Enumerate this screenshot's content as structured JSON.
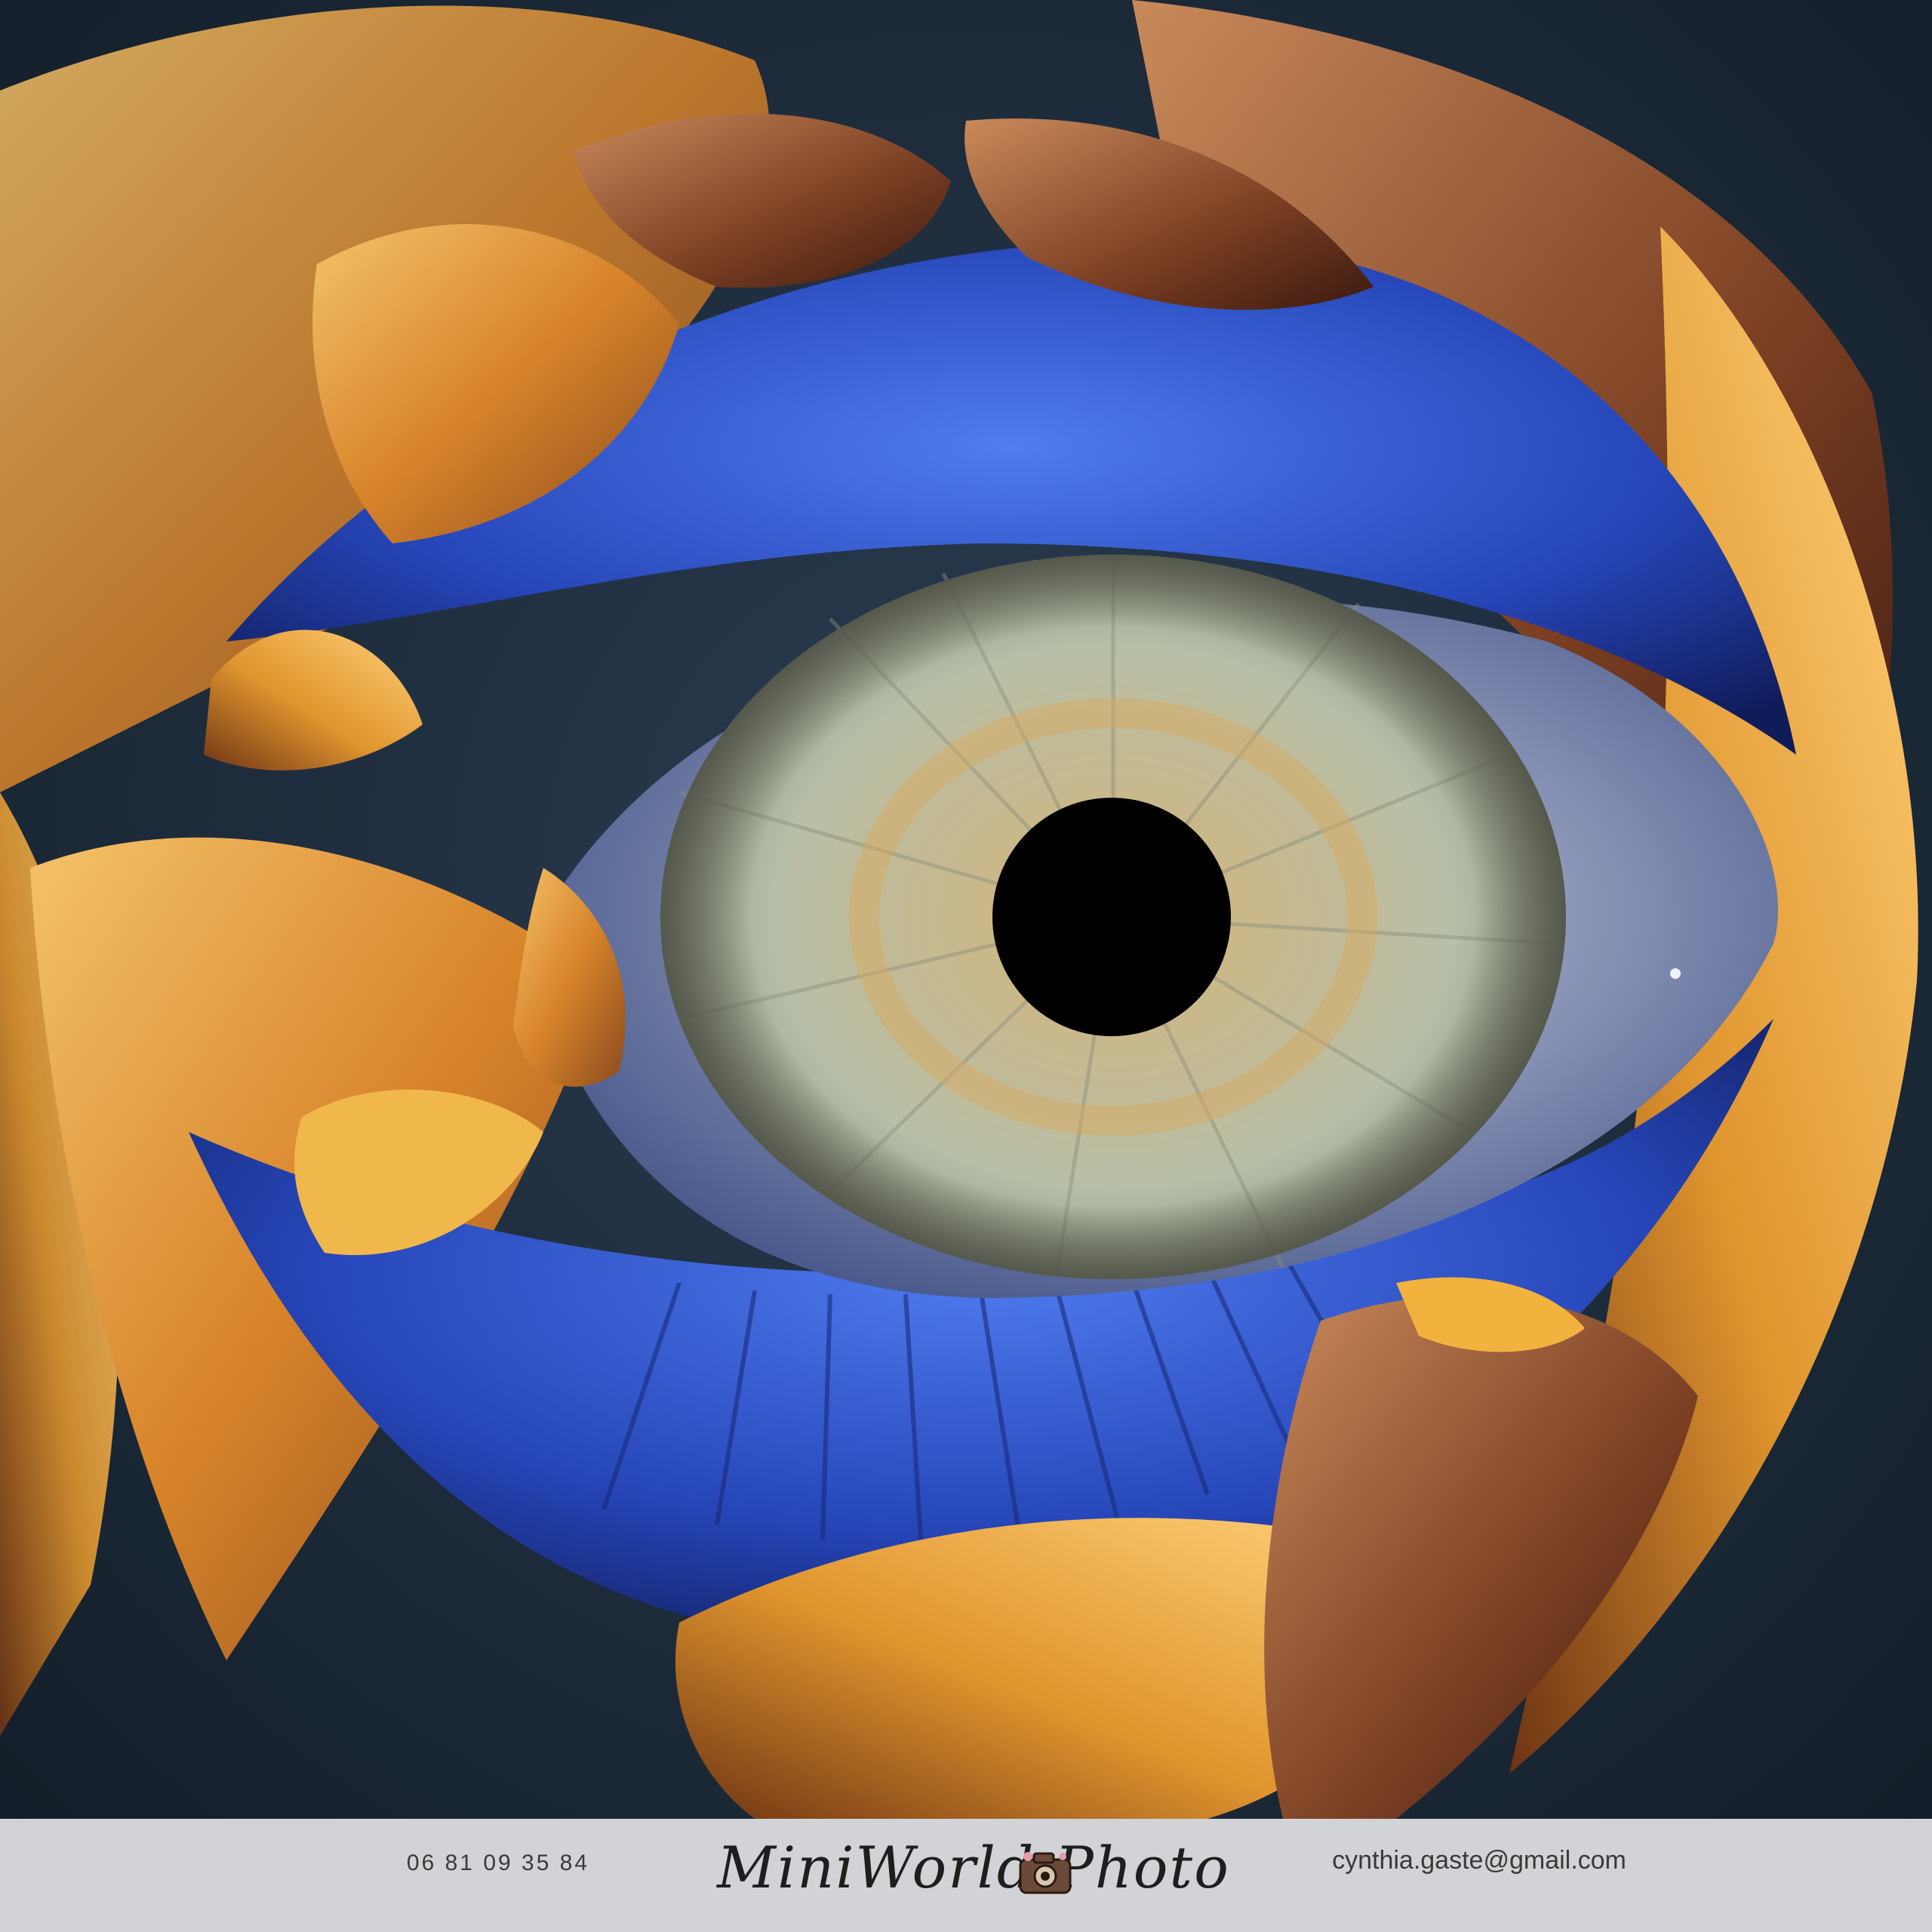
{
  "photo": {
    "subject": "eye-within-flower-petals-artwork",
    "colors": {
      "background": "#1b2a36",
      "petal_orange": "#e39a2e",
      "petal_blue": "#2f56c8",
      "iris": "#c9c39a",
      "pupil": "#000000"
    }
  },
  "footer": {
    "phone": "06 81 09 35 84",
    "email": "cynthia.gaste@gmail.com",
    "brand": "MiniWorld Photo",
    "camera_icon": "camera-icon"
  }
}
